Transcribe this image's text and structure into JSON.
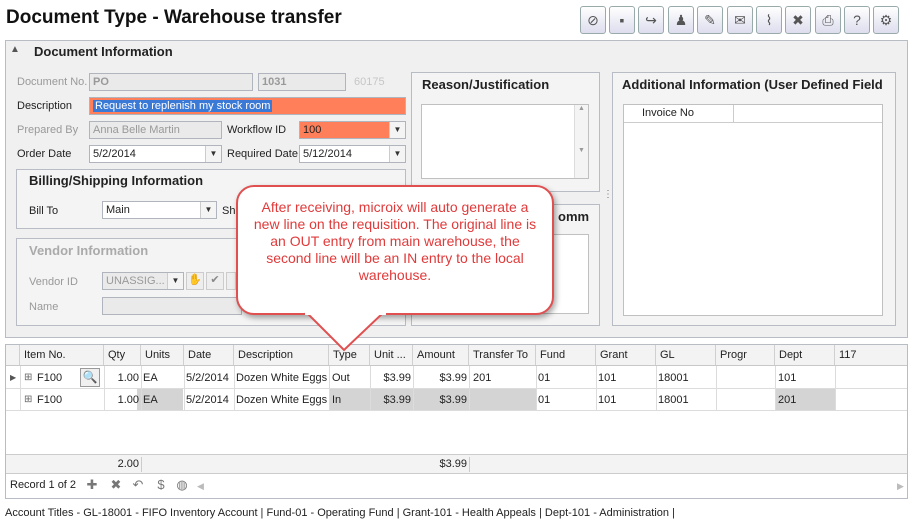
{
  "title": "Document Type - Warehouse transfer",
  "toolbar": [
    "void-icon",
    "save-icon",
    "send-icon",
    "approve-icon",
    "notes-icon",
    "email-icon",
    "attach-icon",
    "delete-icon",
    "print-icon",
    "help-icon",
    "settings-icon"
  ],
  "doc_info": {
    "header": "Document Information",
    "doc_no_label": "Document No.",
    "doc_prefix": "PO",
    "doc_number": "1031",
    "doc_suffix": "60175",
    "description_label": "Description",
    "description": "Request to replenish my stock room",
    "prepared_by_label": "Prepared By",
    "prepared_by": "Anna Belle Martin",
    "workflow_label": "Workflow ID",
    "workflow_id": "100",
    "order_date_label": "Order Date",
    "order_date": "5/2/2014",
    "required_date_label": "Required Date",
    "required_date": "5/12/2014"
  },
  "billing": {
    "header": "Billing/Shipping Information",
    "bill_to_label": "Bill To",
    "bill_to": "Main",
    "ship_label": "Shi"
  },
  "vendor": {
    "header": "Vendor Information",
    "vendor_id_label": "Vendor ID",
    "vendor_id": "UNASSIG...",
    "name_label": "Name"
  },
  "reason": {
    "header": "Reason/Justification",
    "header2": "omm"
  },
  "additional": {
    "header": "Additional Information (User Defined Field",
    "invoice_label": "Invoice No"
  },
  "callout": "After receiving, microix will auto generate a new line on the requisition. The original line is an OUT entry from main warehouse, the second line will be an IN entry to the local warehouse.",
  "grid": {
    "columns": [
      "Item No.",
      "Qty",
      "Units",
      "Date",
      "Description",
      "Type",
      "Unit ...",
      "Amount",
      "Transfer To",
      "Fund",
      "Grant",
      "GL",
      "Progr",
      "Dept",
      "117"
    ],
    "rows": [
      {
        "item": "F100",
        "qty": "1.00",
        "units": "EA",
        "date": "5/2/2014",
        "desc": "Dozen White Eggs",
        "type": "Out",
        "unit": "$3.99",
        "amount": "$3.99",
        "transfer": "201",
        "fund": "01",
        "grant": "101",
        "gl": "18001",
        "progr": "",
        "dept": "101",
        "c117": ""
      },
      {
        "item": "F100",
        "qty": "1.00",
        "units": "EA",
        "date": "5/2/2014",
        "desc": "Dozen White Eggs",
        "type": "In",
        "unit": "$3.99",
        "amount": "$3.99",
        "transfer": "",
        "fund": "01",
        "grant": "101",
        "gl": "18001",
        "progr": "",
        "dept": "201",
        "c117": ""
      }
    ],
    "total_qty": "2.00",
    "total_amount": "$3.99",
    "record_label": "Record 1 of 2"
  },
  "status_bar": "Account Titles - GL-18001 - FIFO Inventory Account | Fund-01 - Operating Fund | Grant-101 - Health Appeals | Dept-101 - Administration |"
}
